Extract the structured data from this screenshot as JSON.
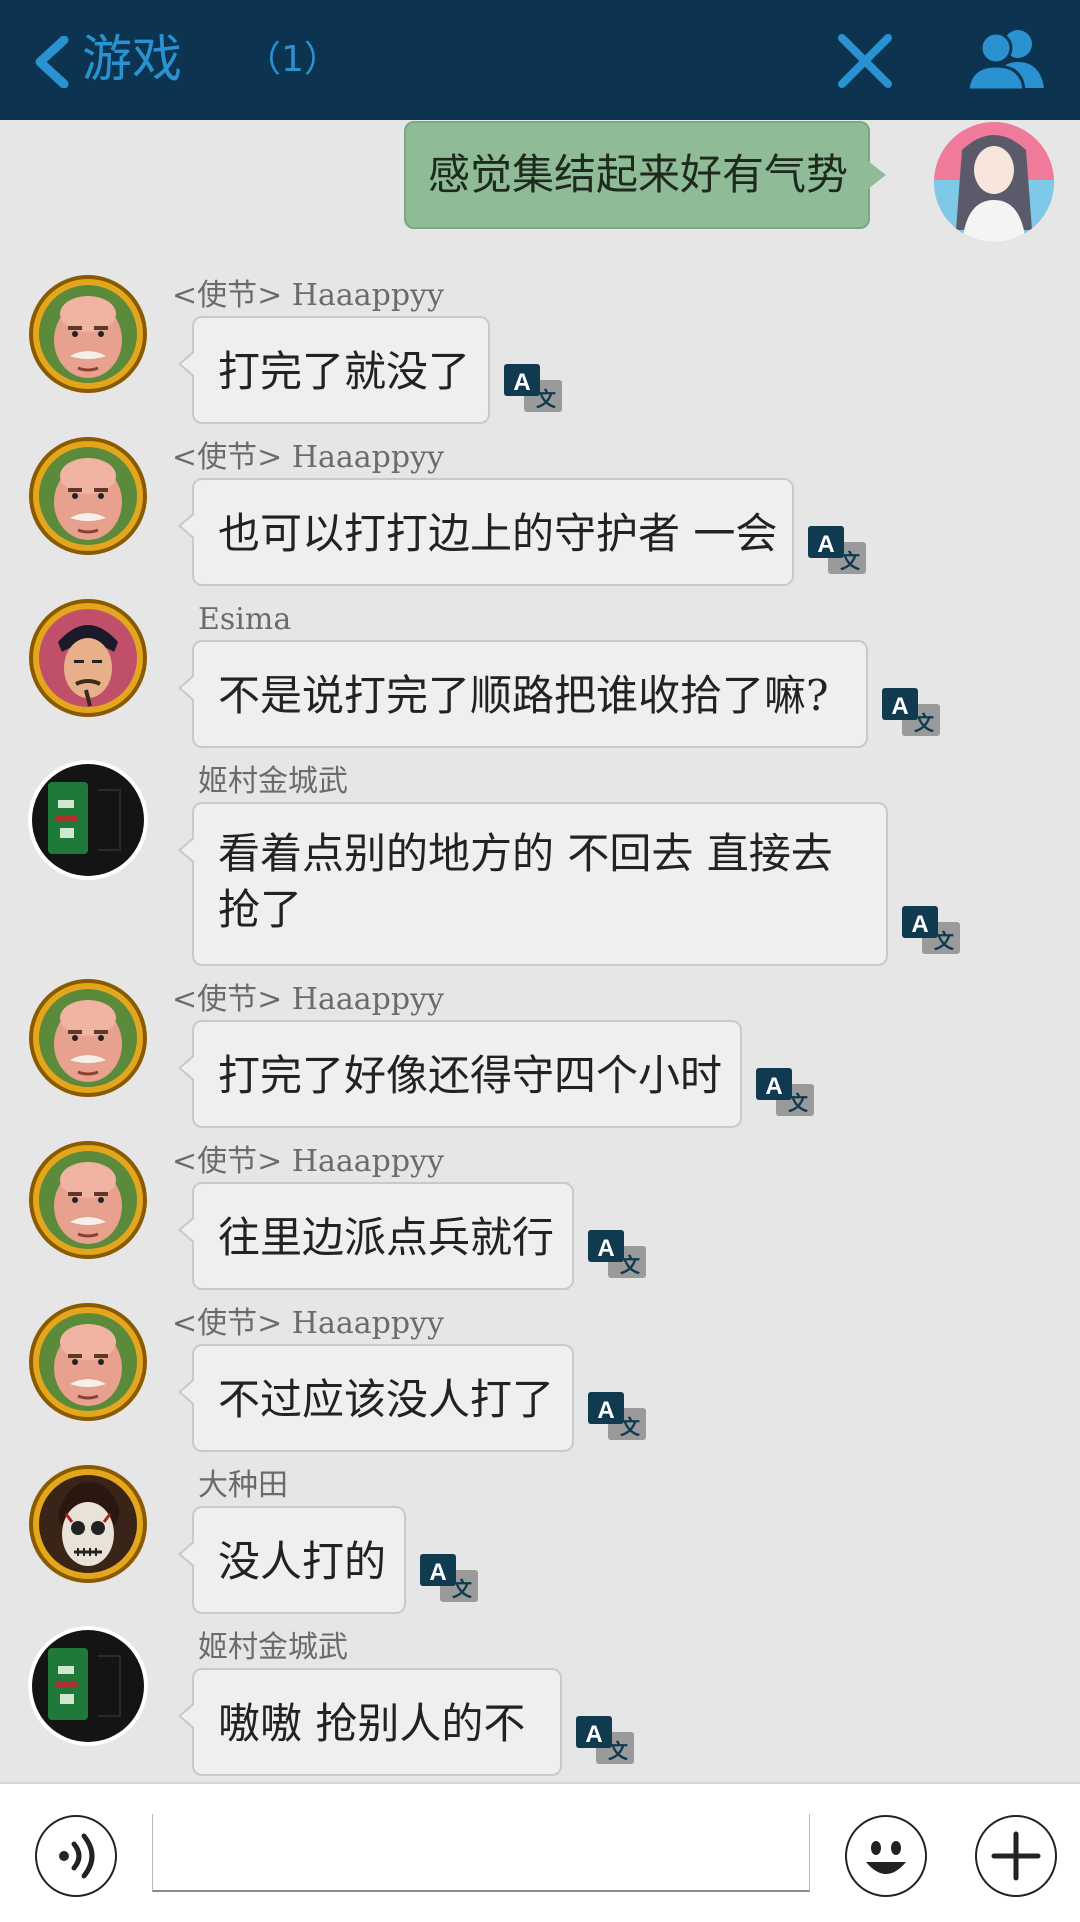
{
  "header": {
    "title": "游戏",
    "count": "（1）",
    "back_icon": "chevron-left-icon",
    "close_icon": "close-icon",
    "members_icon": "users-icon"
  },
  "own_message": {
    "text": "感觉集结起来好有气势"
  },
  "messages": [
    {
      "sender": "<使节>  Haaappyy",
      "text": "打完了就没了"
    },
    {
      "sender": "<使节>  Haaappyy",
      "text": "也可以打打边上的守护者 一会"
    },
    {
      "sender": "Esima",
      "text": "不是说打完了顺路把谁收拾了嘛?"
    },
    {
      "sender": "姬村金城武",
      "line1": "看着点别的地方的  不回去  直接去",
      "line2": "抢了"
    },
    {
      "sender": "<使节>  Haaappyy",
      "text": "打完了好像还得守四个小时"
    },
    {
      "sender": "<使节>  Haaappyy",
      "text": "往里边派点兵就行"
    },
    {
      "sender": "<使节>  Haaappyy",
      "text": "不过应该没人打了"
    },
    {
      "sender": "大种田",
      "text": "没人打的"
    },
    {
      "sender": "姬村金城武",
      "text": "嗷嗷   抢别人的不"
    }
  ],
  "translate_icon": {
    "letter": "A",
    "char": "文"
  },
  "input": {
    "placeholder": ""
  },
  "colors": {
    "header_bg": "#0c3350",
    "accent": "#2a92d0",
    "own_bubble": "#8fbc97",
    "bubble": "#efefef",
    "background": "#e6e6e6"
  }
}
